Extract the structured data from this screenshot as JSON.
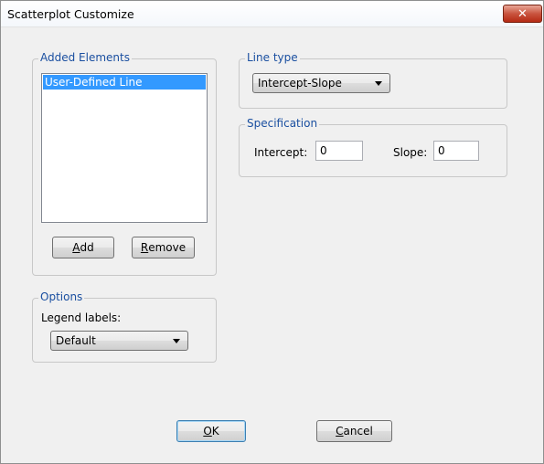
{
  "window": {
    "title": "Scatterplot Customize",
    "close_glyph": "✕"
  },
  "added_elements": {
    "legend": "Added Elements",
    "items": [
      "User-Defined Line"
    ],
    "add_button": {
      "mnemonic": "A",
      "rest": "dd"
    },
    "remove_button": {
      "mnemonic": "R",
      "rest": "emove"
    }
  },
  "options": {
    "legend": "Options",
    "legend_labels_label": "Legend labels:",
    "legend_labels_value": "Default"
  },
  "line_type": {
    "legend": "Line type",
    "value": "Intercept-Slope"
  },
  "specification": {
    "legend": "Specification",
    "intercept_label": "Intercept:",
    "intercept_value": "0",
    "slope_label": "Slope:",
    "slope_value": "0"
  },
  "footer": {
    "ok_button": {
      "mnemonic": "O",
      "rest": "K"
    },
    "cancel_button": {
      "mnemonic": "C",
      "rest": "ancel"
    }
  },
  "colors": {
    "accent": "#1a4fa0",
    "selection": "#3399ff",
    "close": "#c9543f"
  }
}
